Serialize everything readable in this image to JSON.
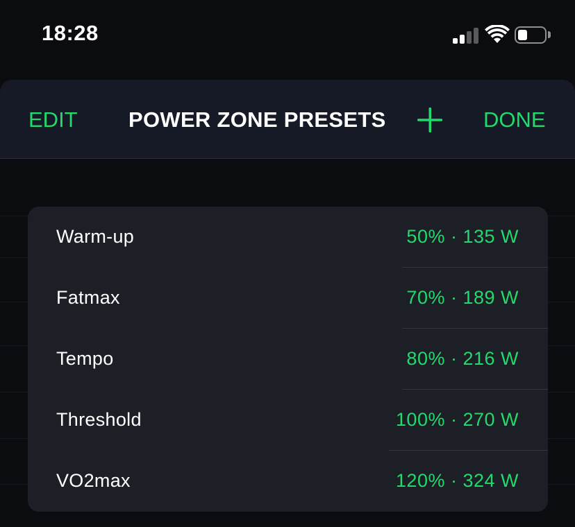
{
  "status_bar": {
    "time": "18:28",
    "signal_icon": "cellular-signal-icon",
    "wifi_icon": "wifi-icon",
    "battery_icon": "battery-icon",
    "battery_level": 0.2
  },
  "header": {
    "edit_label": "EDIT",
    "title": "POWER ZONE PRESETS",
    "add_icon": "plus-icon",
    "done_label": "DONE"
  },
  "presets": [
    {
      "name": "Warm-up",
      "value": "50% · 135 W"
    },
    {
      "name": "Fatmax",
      "value": "70% · 189 W"
    },
    {
      "name": "Tempo",
      "value": "80% · 216 W"
    },
    {
      "name": "Threshold",
      "value": "100% · 270 W"
    },
    {
      "name": "VO2max",
      "value": "120% · 324 W"
    }
  ],
  "colors": {
    "accent": "#22d96b",
    "background": "#0b0c10",
    "header_bg": "#161a26",
    "card_bg": "#1c1f26",
    "text": "#ffffff"
  }
}
